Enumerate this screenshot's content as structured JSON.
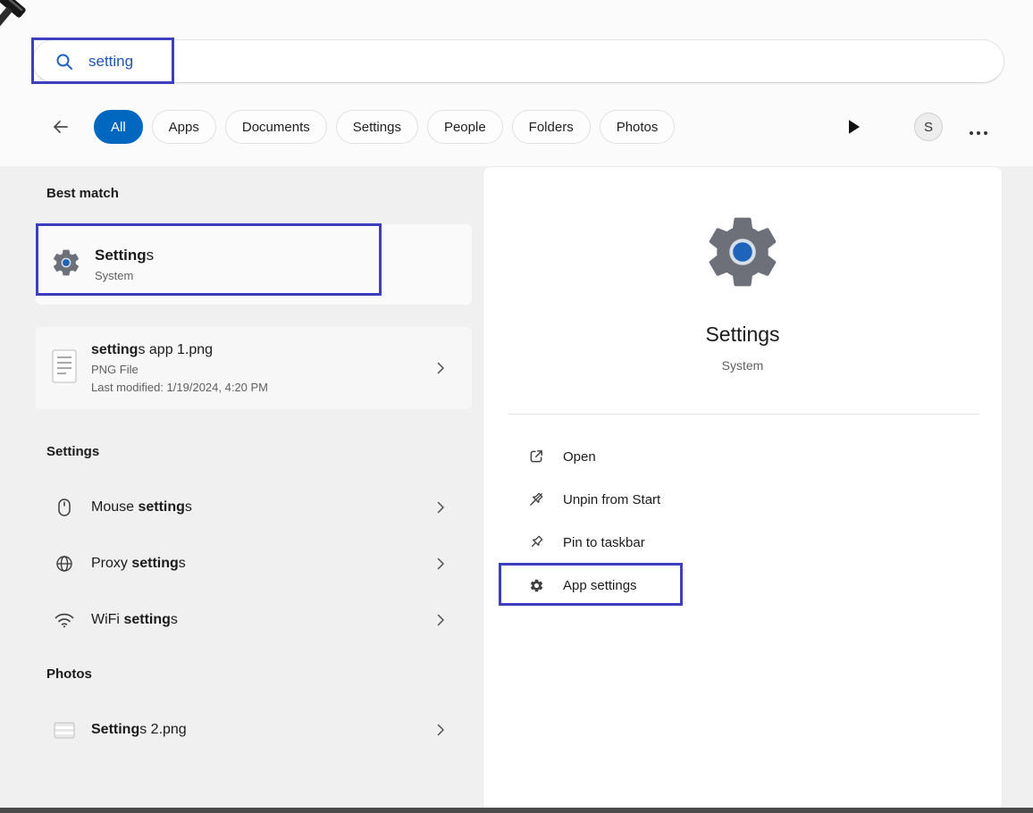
{
  "search": {
    "value": "setting"
  },
  "filter_bar": {
    "tabs": [
      {
        "label": "All",
        "active": true
      },
      {
        "label": "Apps",
        "active": false
      },
      {
        "label": "Documents",
        "active": false
      },
      {
        "label": "Settings",
        "active": false
      },
      {
        "label": "People",
        "active": false
      },
      {
        "label": "Folders",
        "active": false
      },
      {
        "label": "Photos",
        "active": false
      }
    ],
    "avatar_initial": "S"
  },
  "left": {
    "best_match_heading": "Best match",
    "best_match": {
      "title_match": "Setting",
      "title_rest": "s",
      "subtitle": "System"
    },
    "file": {
      "title_match": "setting",
      "title_rest": "s app 1.png",
      "file_type": "PNG File",
      "modified": "Last modified: 1/19/2024, 4:20 PM"
    },
    "settings_heading": "Settings",
    "settings_items": [
      {
        "pre": "Mouse ",
        "match": "setting",
        "post": "s"
      },
      {
        "pre": "Proxy ",
        "match": "setting",
        "post": "s"
      },
      {
        "pre": "WiFi ",
        "match": "setting",
        "post": "s"
      }
    ],
    "photos_heading": "Photos",
    "photos_items": [
      {
        "pre": "",
        "match": "Setting",
        "post": "s 2.png"
      }
    ]
  },
  "preview": {
    "title": "Settings",
    "subtitle": "System",
    "actions": [
      {
        "label": "Open"
      },
      {
        "label": "Unpin from Start"
      },
      {
        "label": "Pin to taskbar"
      },
      {
        "label": "App settings"
      }
    ]
  },
  "colors": {
    "accent_blue": "#0067c0",
    "search_text_blue": "#1f55b0",
    "annotation_purple": "#3e3ec1",
    "gear_gray": "#6d7079",
    "gear_center_blue": "#1e64bb"
  }
}
